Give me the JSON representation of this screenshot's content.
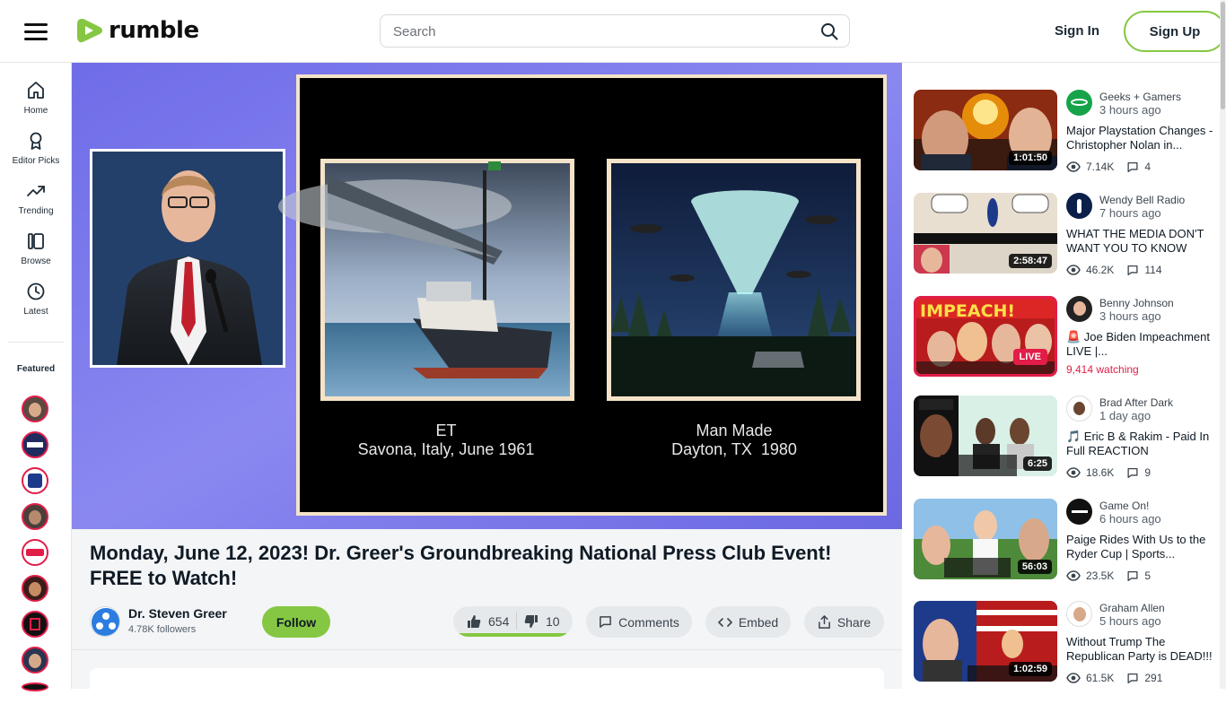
{
  "header": {
    "logo_text": "rumble",
    "search_placeholder": "Search",
    "signin_label": "Sign In",
    "signup_label": "Sign Up",
    "brand_color": "#85c742"
  },
  "sidebar": {
    "items": [
      {
        "label": "Home",
        "icon": "home-icon"
      },
      {
        "label": "Editor Picks",
        "icon": "ribbon-icon"
      },
      {
        "label": "Trending",
        "icon": "trending-icon"
      },
      {
        "label": "Browse",
        "icon": "browse-icon"
      },
      {
        "label": "Latest",
        "icon": "clock-icon"
      }
    ],
    "featured_label": "Featured"
  },
  "player": {
    "slide_left_caption": "ET",
    "slide_left_sub": "Savona, Italy, June 1961",
    "slide_right_caption": "Man Made",
    "slide_right_sub": "Dayton, TX  1980"
  },
  "video": {
    "title": "Monday, June 12, 2023! Dr. Greer's Groundbreaking National Press Club Event! FREE to Watch!",
    "channel_name": "Dr. Steven Greer",
    "followers": "4.78K followers",
    "follow_label": "Follow",
    "likes": "654",
    "dislikes": "10",
    "like_ratio": 0.985,
    "comments_label": "Comments",
    "embed_label": "Embed",
    "share_label": "Share"
  },
  "recommended": [
    {
      "channel": "Geeks + Gamers",
      "time": "3 hours ago",
      "title": "Major Playstation Changes - Christopher Nolan in...",
      "duration": "1:01:50",
      "views": "7.14K",
      "comments": "4"
    },
    {
      "channel": "Wendy Bell Radio",
      "time": "7 hours ago",
      "title": "WHAT THE MEDIA DON'T WANT YOU TO KNOW",
      "duration": "2:58:47",
      "views": "46.2K",
      "comments": "114"
    },
    {
      "channel": "Benny Johnson",
      "time": "3 hours ago",
      "title": "🚨 Joe Biden Impeachment LIVE |...",
      "live_label": "LIVE",
      "watching": "9,414 watching"
    },
    {
      "channel": "Brad After Dark",
      "time": "1 day ago",
      "title": "🎵 Eric B & Rakim - Paid In Full REACTION",
      "duration": "6:25",
      "views": "18.6K",
      "comments": "9"
    },
    {
      "channel": "Game On!",
      "time": "6 hours ago",
      "title": "Paige Rides With Us to the Ryder Cup | Sports...",
      "duration": "56:03",
      "views": "23.5K",
      "comments": "5"
    },
    {
      "channel": "Graham Allen",
      "time": "5 hours ago",
      "title": "Without Trump The Republican Party is DEAD!!!",
      "duration": "1:02:59",
      "views": "61.5K",
      "comments": "291"
    }
  ]
}
